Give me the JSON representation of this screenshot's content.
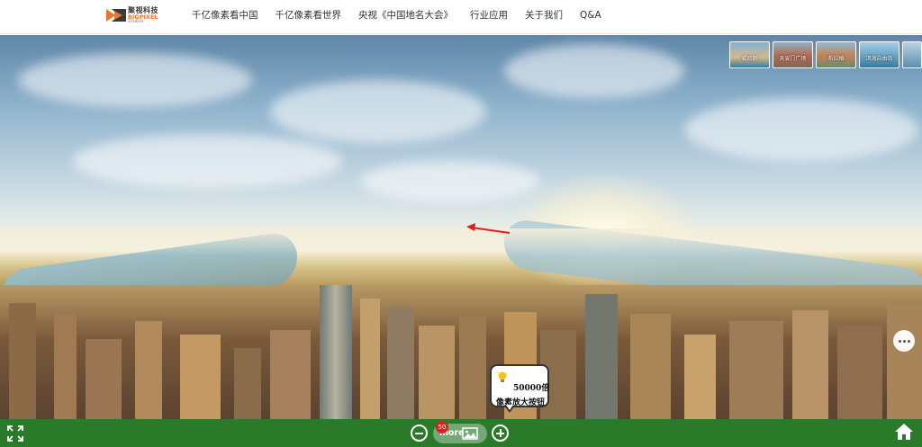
{
  "brand": {
    "name_cn": "聚视科技",
    "name_en": "BIGPIXEL",
    "name_sub": "STUDIO",
    "accent_color": "#e9752d"
  },
  "nav": {
    "items": [
      {
        "label": "千亿像素看中国"
      },
      {
        "label": "千亿像素看世界"
      },
      {
        "label": "央视《中国地名大会》"
      },
      {
        "label": "行业应用"
      },
      {
        "label": "关于我们"
      },
      {
        "label": "Q&A"
      }
    ]
  },
  "thumbnails": [
    {
      "label": "威尼斯"
    },
    {
      "label": "天安门广场"
    },
    {
      "label": "布拉格"
    },
    {
      "label": "洱海自由岛"
    },
    {
      "label": ""
    }
  ],
  "tooltip": {
    "line1": "50000倍",
    "line2": "像素放大按钮"
  },
  "toolbar": {
    "more_label": "more",
    "badge_count": "50",
    "bar_color": "#2a7a2a"
  },
  "icons": {
    "fullscreen": "fullscreen-icon",
    "zoom_out": "zoom-out-icon",
    "zoom_in": "zoom-in-icon",
    "gallery": "image-icon",
    "home": "home-icon",
    "more": "more-dots-icon",
    "bulb": "light-bulb-icon"
  }
}
